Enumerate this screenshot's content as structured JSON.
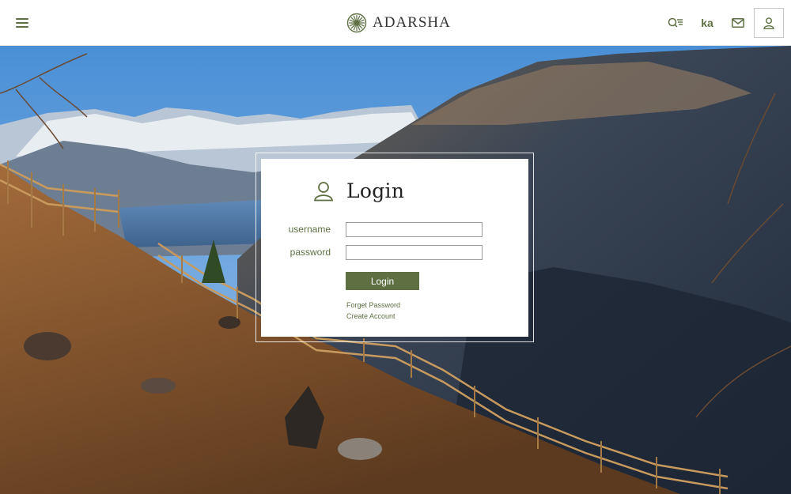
{
  "header": {
    "brand_name": "ADARSHA",
    "lang_label": "ka",
    "icons": [
      "menu-icon",
      "logo-icon",
      "search-list-icon",
      "mail-icon",
      "user-icon"
    ],
    "accent_color": "#5e7042"
  },
  "login": {
    "title": "Login",
    "username_label": "username",
    "password_label": "password",
    "username_value": "",
    "password_value": "",
    "button_label": "Login",
    "forget_password": "Forget Password",
    "create_account": "Create Account"
  }
}
